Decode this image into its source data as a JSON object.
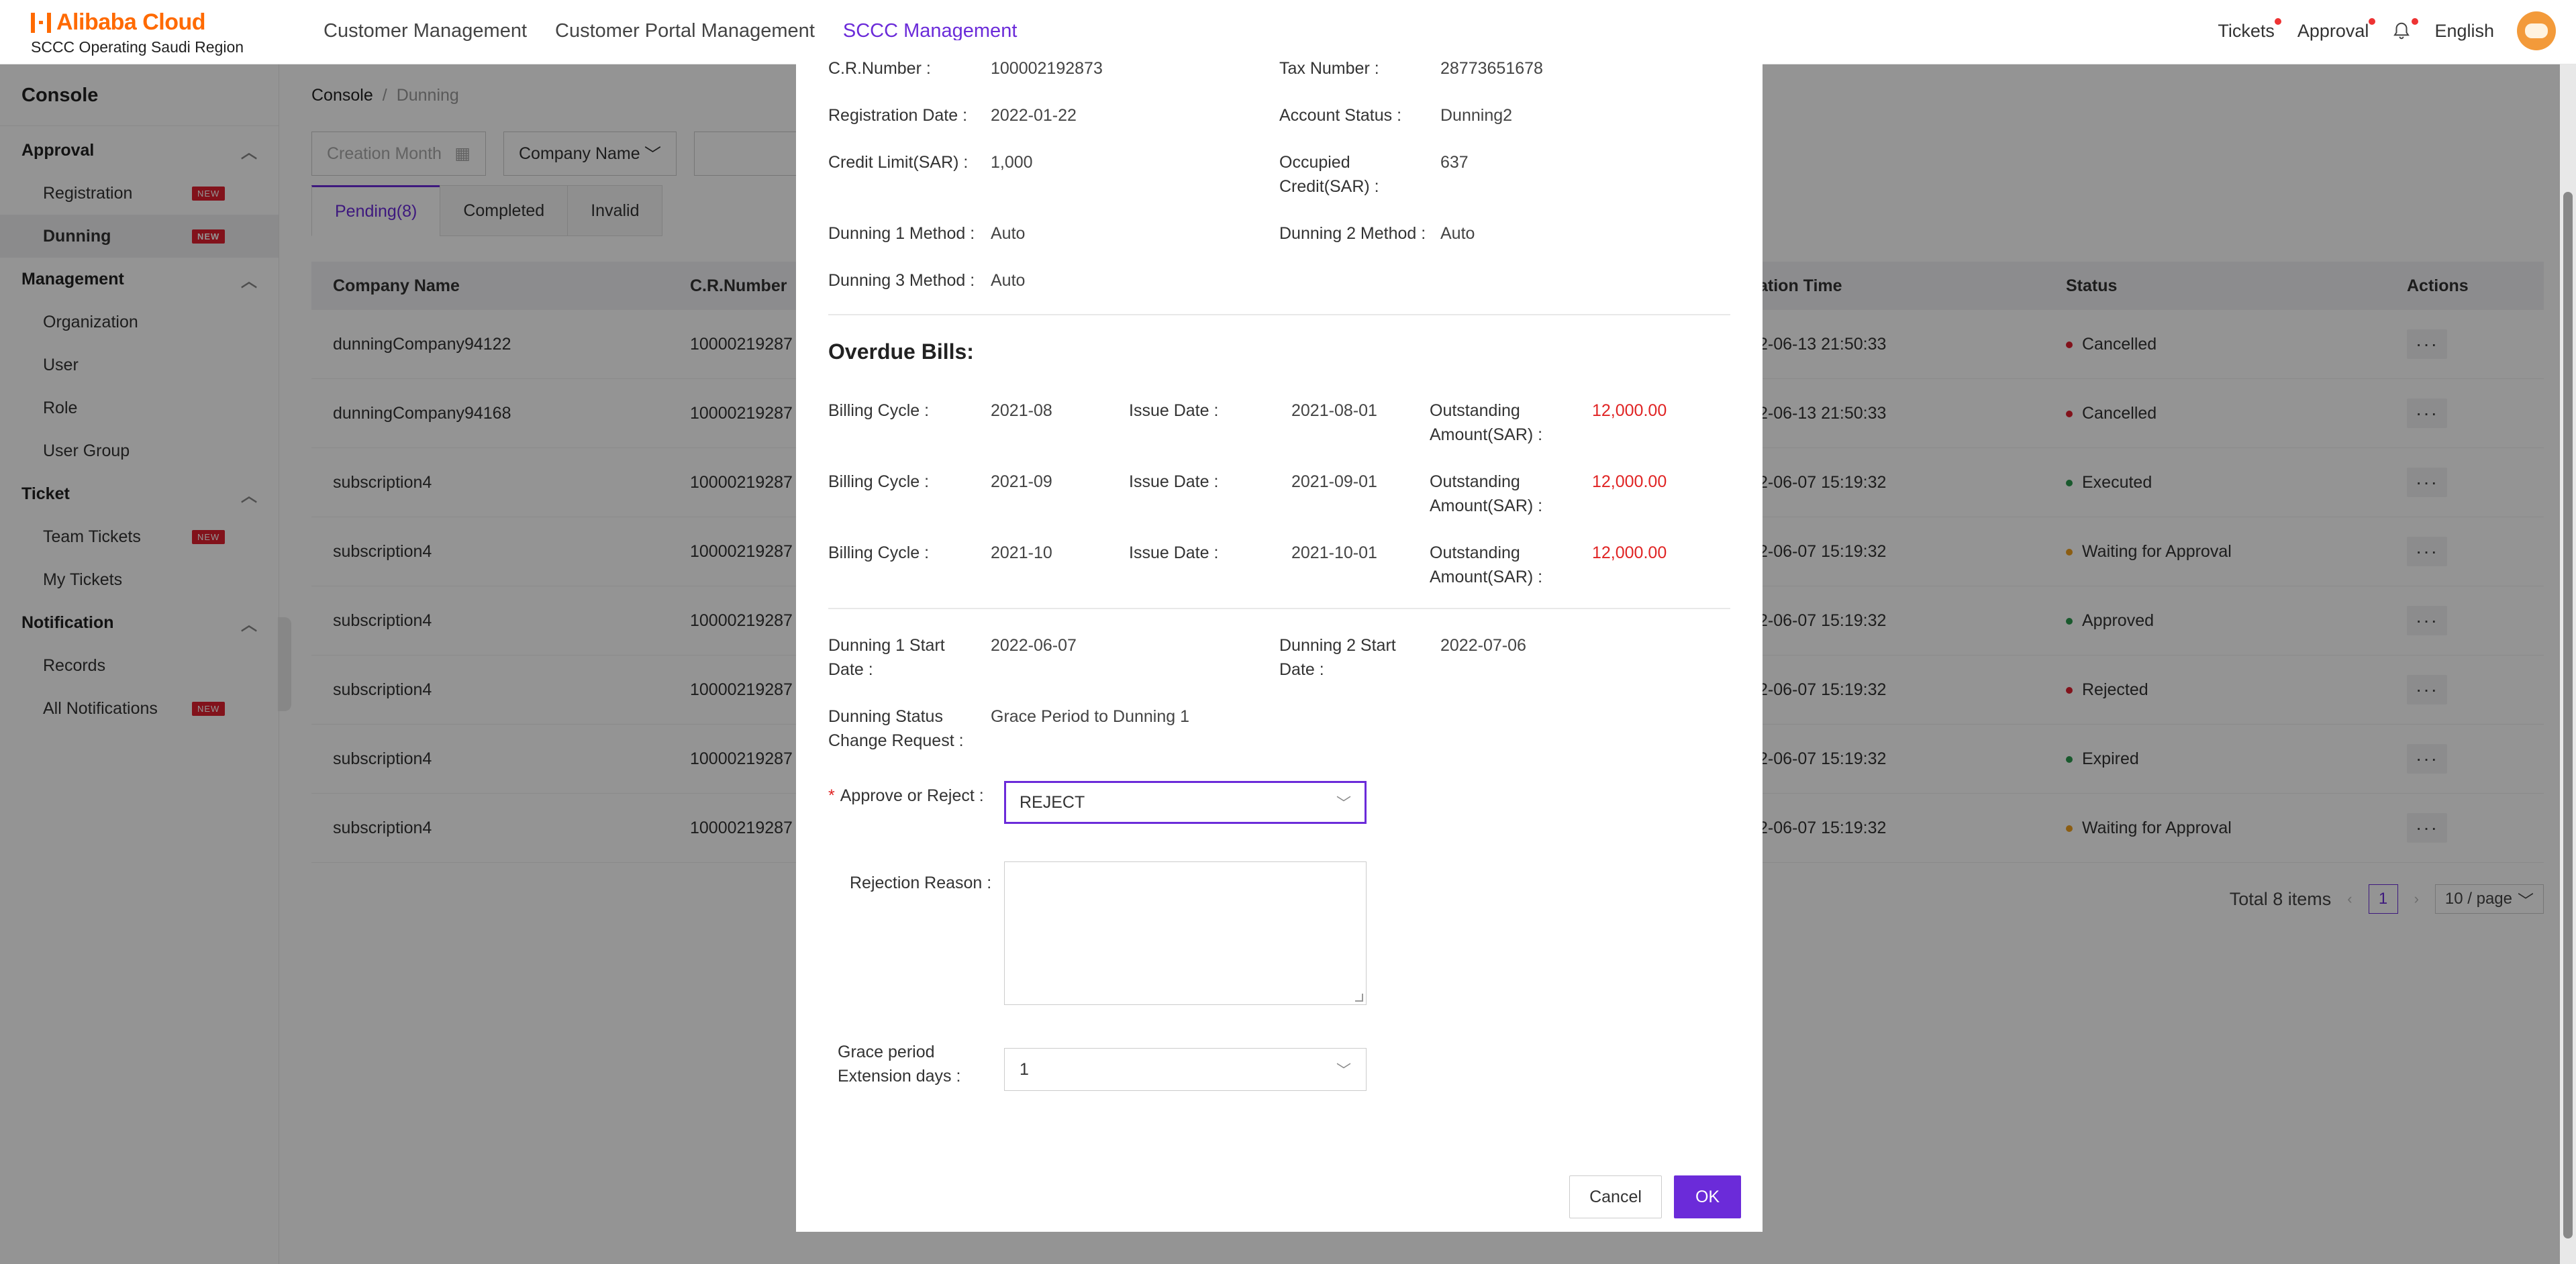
{
  "header": {
    "logo_text": "Alibaba Cloud",
    "logo_subtitle": "SCCC Operating Saudi Region",
    "nav": [
      "Customer Management",
      "Customer Portal Management",
      "SCCC Management"
    ],
    "tickets": "Tickets",
    "approval": "Approval",
    "language": "English"
  },
  "sidebar": {
    "title": "Console",
    "badge": "NEW",
    "sections": [
      {
        "label": "Approval",
        "items": [
          "Registration",
          "Dunning"
        ]
      },
      {
        "label": "Management",
        "items": [
          "Organization",
          "User",
          "Role",
          "User Group"
        ]
      },
      {
        "label": "Ticket",
        "items": [
          "Team Tickets",
          "My Tickets"
        ]
      },
      {
        "label": "Notification",
        "items": [
          "Records",
          "All Notifications"
        ]
      }
    ]
  },
  "main": {
    "breadcrumb_root": "Console",
    "breadcrumb_current": "Dunning",
    "filter_creation_placeholder": "Creation Month",
    "filter_company": "Company Name",
    "tabs": [
      "Pending(8)",
      "Completed",
      "Invalid"
    ],
    "columns": {
      "company": "Company Name",
      "cr": "C.R.Number",
      "time": "ation Time",
      "status": "Status",
      "actions": "Actions"
    },
    "rows": [
      {
        "company": "dunningCompany94122",
        "cr": "10000219287",
        "time": "2-06-13 21:50:33",
        "status": "Cancelled",
        "color": "#e0202f"
      },
      {
        "company": "dunningCompany94168",
        "cr": "10000219287",
        "time": "2-06-13 21:50:33",
        "status": "Cancelled",
        "color": "#e0202f"
      },
      {
        "company": "subscription4",
        "cr": "10000219287",
        "time": "2-06-07 15:19:32",
        "status": "Executed",
        "color": "#2c9a4e"
      },
      {
        "company": "subscription4",
        "cr": "10000219287",
        "time": "2-06-07 15:19:32",
        "status": "Waiting for Approval",
        "color": "#f0a020"
      },
      {
        "company": "subscription4",
        "cr": "10000219287",
        "time": "2-06-07 15:19:32",
        "status": "Approved",
        "color": "#2c9a4e"
      },
      {
        "company": "subscription4",
        "cr": "10000219287",
        "time": "2-06-07 15:19:32",
        "status": "Rejected",
        "color": "#e0202f"
      },
      {
        "company": "subscription4",
        "cr": "10000219287",
        "time": "2-06-07 15:19:32",
        "status": "Expired",
        "color": "#2c9a4e"
      },
      {
        "company": "subscription4",
        "cr": "10000219287",
        "time": "2-06-07 15:19:32",
        "status": "Waiting for Approval",
        "color": "#f0a020"
      }
    ],
    "pager_total": "Total 8 items",
    "pager_page": "1",
    "pager_size": "10 / page"
  },
  "modal": {
    "cr_label": "C.R.Number :",
    "cr_value": "100002192873",
    "tax_label": "Tax Number :",
    "tax_value": "28773651678",
    "reg_label": "Registration Date :",
    "reg_value": "2022-01-22",
    "acct_label": "Account Status :",
    "acct_value": "Dunning2",
    "credit_label": "Credit Limit(SAR) :",
    "credit_value": "1,000",
    "occupied_label_1": "Occupied",
    "occupied_label_2": "Credit(SAR) :",
    "occupied_value": "637",
    "d1m_label": "Dunning 1 Method :",
    "d1m_value": "Auto",
    "d2m_label": "Dunning 2 Method :",
    "d2m_value": "Auto",
    "d3m_label": "Dunning 3 Method :",
    "d3m_value": "Auto",
    "overdue_title": "Overdue Bills:",
    "bills": [
      {
        "cycle_label": "Billing Cycle :",
        "cycle": "2021-08",
        "issue_label": "Issue Date :",
        "issue": "2021-08-01",
        "out_label_1": "Outstanding",
        "out_label_2": "Amount(SAR) :",
        "amount": "12,000.00"
      },
      {
        "cycle_label": "Billing Cycle :",
        "cycle": "2021-09",
        "issue_label": "Issue Date :",
        "issue": "2021-09-01",
        "out_label_1": "Outstanding",
        "out_label_2": "Amount(SAR) :",
        "amount": "12,000.00"
      },
      {
        "cycle_label": "Billing Cycle :",
        "cycle": "2021-10",
        "issue_label": "Issue Date :",
        "issue": "2021-10-01",
        "out_label_1": "Outstanding",
        "out_label_2": "Amount(SAR) :",
        "amount": "12,000.00"
      }
    ],
    "d1s_label_1": "Dunning 1 Start",
    "d1s_label_2": "Date :",
    "d1s_value": "2022-06-07",
    "d2s_label_1": "Dunning 2 Start",
    "d2s_label_2": "Date :",
    "d2s_value": "2022-07-06",
    "dscr_label_1": "Dunning Status",
    "dscr_label_2": "Change Request :",
    "dscr_value": "Grace Period to Dunning 1",
    "approve_label": "Approve or Reject :",
    "approve_value": "REJECT",
    "rejection_label": "Rejection Reason :",
    "grace_label_1": "Grace period",
    "grace_label_2": "Extension days :",
    "grace_value": "1",
    "cancel": "Cancel",
    "ok": "OK"
  },
  "colors": {
    "accent": "#6b2bd9",
    "brand": "#ff6a00",
    "alert": "#e02424"
  }
}
